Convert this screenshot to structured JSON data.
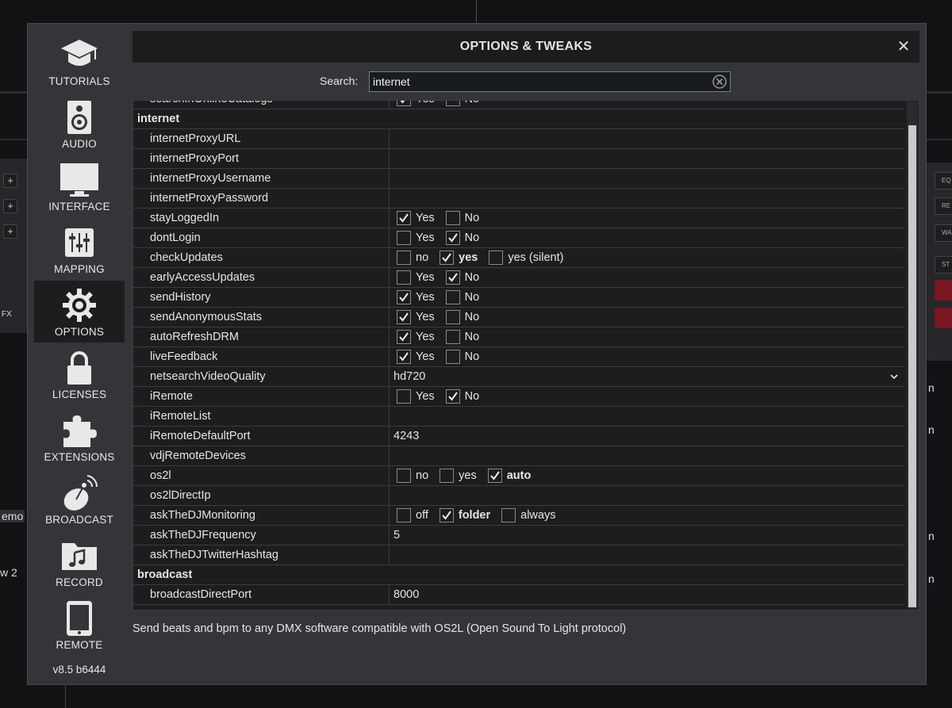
{
  "dialog": {
    "title": "OPTIONS & TWEAKS",
    "close_glyph": "✕",
    "version": "v8.5 b6444",
    "description": "Send beats and bpm to any DMX software compatible with OS2L (Open Sound To Light protocol)"
  },
  "search": {
    "label": "Search:",
    "value": "internet"
  },
  "sidebar": {
    "items": [
      {
        "label": "TUTORIALS",
        "icon": "graduation-cap-icon"
      },
      {
        "label": "AUDIO",
        "icon": "speaker-icon"
      },
      {
        "label": "INTERFACE",
        "icon": "monitor-icon"
      },
      {
        "label": "MAPPING",
        "icon": "sliders-icon"
      },
      {
        "label": "OPTIONS",
        "icon": "gear-icon"
      },
      {
        "label": "LICENSES",
        "icon": "lock-icon"
      },
      {
        "label": "EXTENSIONS",
        "icon": "puzzle-icon"
      },
      {
        "label": "BROADCAST",
        "icon": "satellite-dish-icon"
      },
      {
        "label": "RECORD",
        "icon": "music-folder-icon"
      },
      {
        "label": "REMOTE",
        "icon": "tablet-icon"
      }
    ]
  },
  "rows": [
    {
      "name": "searchInOnlineCatalogs",
      "options": [
        {
          "label": "Yes",
          "checked": true
        },
        {
          "label": "No",
          "checked": false
        }
      ]
    },
    {
      "name": "internet",
      "section": true
    },
    {
      "name": "internetProxyURL",
      "value": ""
    },
    {
      "name": "internetProxyPort",
      "value": ""
    },
    {
      "name": "internetProxyUsername",
      "value": ""
    },
    {
      "name": "internetProxyPassword",
      "value": ""
    },
    {
      "name": "stayLoggedIn",
      "options": [
        {
          "label": "Yes",
          "checked": true
        },
        {
          "label": "No",
          "checked": false
        }
      ]
    },
    {
      "name": "dontLogin",
      "options": [
        {
          "label": "Yes",
          "checked": false
        },
        {
          "label": "No",
          "checked": true
        }
      ]
    },
    {
      "name": "checkUpdates",
      "options": [
        {
          "label": "no",
          "checked": false
        },
        {
          "label": "yes",
          "checked": true
        },
        {
          "label": "yes (silent)",
          "checked": false
        }
      ]
    },
    {
      "name": "earlyAccessUpdates",
      "options": [
        {
          "label": "Yes",
          "checked": false
        },
        {
          "label": "No",
          "checked": true
        }
      ]
    },
    {
      "name": "sendHistory",
      "options": [
        {
          "label": "Yes",
          "checked": true
        },
        {
          "label": "No",
          "checked": false
        }
      ]
    },
    {
      "name": "sendAnonymousStats",
      "options": [
        {
          "label": "Yes",
          "checked": true
        },
        {
          "label": "No",
          "checked": false
        }
      ]
    },
    {
      "name": "autoRefreshDRM",
      "options": [
        {
          "label": "Yes",
          "checked": true
        },
        {
          "label": "No",
          "checked": false
        }
      ]
    },
    {
      "name": "liveFeedback",
      "options": [
        {
          "label": "Yes",
          "checked": true
        },
        {
          "label": "No",
          "checked": false
        }
      ]
    },
    {
      "name": "netsearchVideoQuality",
      "value": "hd720",
      "dropdown": true
    },
    {
      "name": "iRemote",
      "options": [
        {
          "label": "Yes",
          "checked": false
        },
        {
          "label": "No",
          "checked": true
        }
      ]
    },
    {
      "name": "iRemoteList",
      "value": ""
    },
    {
      "name": "iRemoteDefaultPort",
      "value": "4243"
    },
    {
      "name": "vdjRemoteDevices",
      "value": ""
    },
    {
      "name": "os2l",
      "options": [
        {
          "label": "no",
          "checked": false
        },
        {
          "label": "yes",
          "checked": false
        },
        {
          "label": "auto",
          "checked": true
        }
      ]
    },
    {
      "name": "os2lDirectIp",
      "value": ""
    },
    {
      "name": "askTheDJMonitoring",
      "options": [
        {
          "label": "off",
          "checked": false
        },
        {
          "label": "folder",
          "checked": true
        },
        {
          "label": "always",
          "checked": false
        }
      ]
    },
    {
      "name": "askTheDJFrequency",
      "value": "5"
    },
    {
      "name": "askTheDJTwitterHashtag",
      "value": ""
    },
    {
      "name": "broadcast",
      "section": true
    },
    {
      "name": "broadcastDirectPort",
      "value": "8000"
    }
  ],
  "background": {
    "left_texts": [
      "FX",
      "emo",
      "w 2"
    ],
    "right_buttons": [
      "EQ",
      "RE",
      "WA",
      "ST"
    ],
    "right_texts": [
      "n",
      "n",
      "n",
      "n"
    ]
  }
}
